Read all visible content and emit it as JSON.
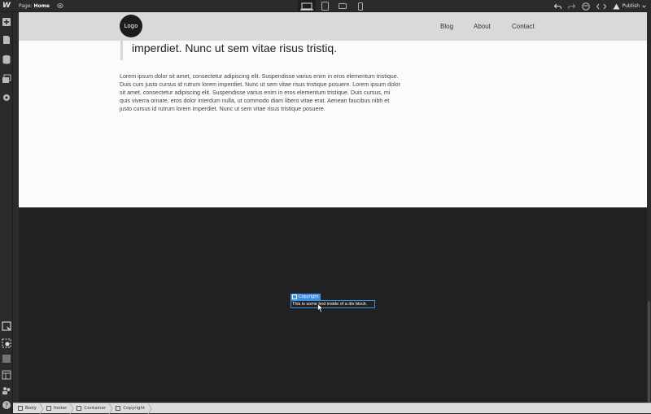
{
  "topbar": {
    "page_label": "Page:",
    "page_name": "Home",
    "publish_label": "Publish",
    "icons": [
      "webflow-logo-icon",
      "eye-icon",
      "desktop-icon",
      "tablet-icon",
      "mobile-landscape-icon",
      "mobile-portrait-icon",
      "undo-icon",
      "redo-icon",
      "wordpress-icon",
      "code-icon",
      "publish-icon"
    ]
  },
  "left_toolbar": {
    "icons": [
      "add-panel-icon",
      "pages-icon",
      "cms-icon",
      "assets-icon",
      "settings-icon",
      "navigator-icon",
      "style-select-icon",
      "audit-icon",
      "interactions-icon",
      "users-icon",
      "help-icon"
    ]
  },
  "site": {
    "logo": "Logo",
    "nav_links": [
      "Blog",
      "About",
      "Contact"
    ],
    "quote_tail": "imperdiet. Nunc ut sem vitae risus tristiq.",
    "paragraph": "Lorem ipsum dolor sit amet, consectetur adipiscing elit. Suspendisse varius enim in eros elementum tristique. Duis curs justo cursus id rutrum lorem imperdiet. Nunc ut sem vitae risus tristique posuere. Lorem ipsum dolor sit amet, consectetur adipiscing elit. Suspendisse varius enim in eros elementum tristique. Duis cursus, mi quis viverra ornare, eros dolor interdum nulla, ut commodo diam libero vitae erat. Aenean faucibus nibh et justo cursus id rutrum lorem imperdiet. Nunc ut sem vitae risus tristique posuere.",
    "selected_label": "Copyright",
    "selected_text": "This is some text inside of a div block."
  },
  "breadcrumb": {
    "items": [
      "Body",
      "footer",
      "Container",
      "Copyright"
    ]
  },
  "colors": {
    "accent": "#3d8fe0",
    "footer_bg": "#212123",
    "nav_bg": "#d9d9d9"
  }
}
